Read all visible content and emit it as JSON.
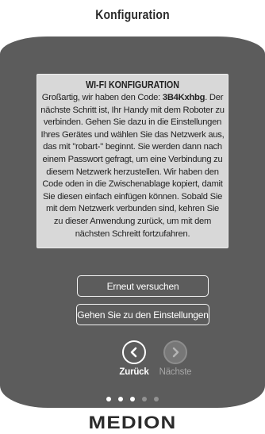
{
  "header": {
    "title": "Konfiguration"
  },
  "info": {
    "title": "WI-FI KONFIGURATION",
    "text_before_code": "Großartig, wir haben den Code: ",
    "code": "3B4Kxhbg",
    "text_after_code": ". Der nächste Schritt ist, Ihr Handy mit dem Roboter zu verbinden. Gehen Sie dazu in die Einstellungen Ihres Gerätes und wählen Sie das Netzwerk aus, das mit \"robart-\" beginnt. Sie werden dann nach einem Passwort gefragt, um eine Verbindung zu diesem Netzwerk herzustellen. Wir haben den Code oden in die Zwischenablage kopiert, damit Sie diesen einfach einfügen können. Sobald Sie mit dem Netzwerk verbunden sind, kehren Sie zu dieser Anwendung zurück, um mit dem nächsten Schreitt fortzufahren."
  },
  "buttons": {
    "retry": "Erneut versuchen",
    "settings": "Gehen Sie zu den Einstellungen"
  },
  "nav": {
    "back_label": "Zurück",
    "back_icon": "chevron-left-icon",
    "next_label": "Nächste",
    "next_icon": "chevron-right-icon"
  },
  "pagination": {
    "total": 5,
    "filled": 3
  },
  "brand": {
    "logo_text": "MEDION"
  },
  "colors": {
    "panel": "#5c5c5c",
    "box": "#d8d8d8",
    "text_light": "#ffffff",
    "text_disabled": "#a7a7a7"
  }
}
